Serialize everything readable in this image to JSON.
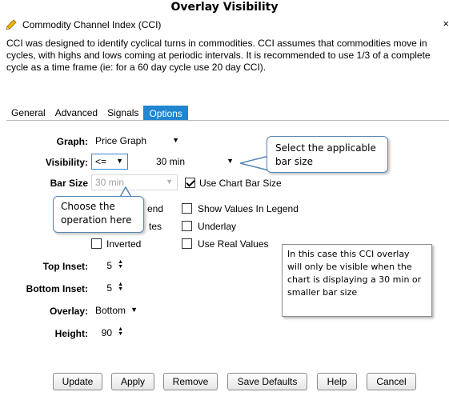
{
  "page_title": "Overlay Visibility",
  "window": {
    "title": "Commodity Channel Index (CCI)",
    "close_glyph": "×",
    "description": "CCI was designed to identify cyclical turns in commodities. CCI assumes that commodities move in cycles, with highs and lows coming at periodic intervals. It is recommended to use 1/3 of a complete cycle as a time frame (ie: for a 60 day cycle use 20 day CCI)."
  },
  "tabs": [
    "General",
    "Advanced",
    "Signals",
    "Options"
  ],
  "active_tab": "Options",
  "form": {
    "graph": {
      "label": "Graph:",
      "value": "Price Graph"
    },
    "visibility": {
      "label": "Visibility:",
      "operator": "<=",
      "value": "30 min"
    },
    "bar_size": {
      "label": "Bar Size",
      "value": "30 min"
    },
    "use_chart_bar_size": {
      "label": "Use Chart Bar Size",
      "checked": true
    },
    "show_in_legend_partial": "end",
    "show_values_in_legend": {
      "label": "Show Values In Legend",
      "checked": false
    },
    "dates_partial": "tes",
    "underlay": {
      "label": "Underlay",
      "checked": false
    },
    "inverted": {
      "label": "Inverted",
      "checked": false
    },
    "use_real_values": {
      "label": "Use Real Values",
      "checked": false
    },
    "top_inset": {
      "label": "Top Inset:",
      "value": "5"
    },
    "bottom_inset": {
      "label": "Bottom Inset:",
      "value": "5"
    },
    "overlay": {
      "label": "Overlay:",
      "value": "Bottom"
    },
    "height": {
      "label": "Height:",
      "value": "90"
    }
  },
  "callouts": {
    "bar_size": "Select the applicable bar size",
    "operation": "Choose the operation here",
    "note": "In this case this CCI overlay will only be visible when the chart is displaying a 30 min or smaller bar size"
  },
  "buttons": [
    "Update",
    "Apply",
    "Remove",
    "Save Defaults",
    "Help",
    "Cancel"
  ],
  "colors": {
    "active_tab": "#1f86cf",
    "callout_border": "#5a87b5"
  }
}
